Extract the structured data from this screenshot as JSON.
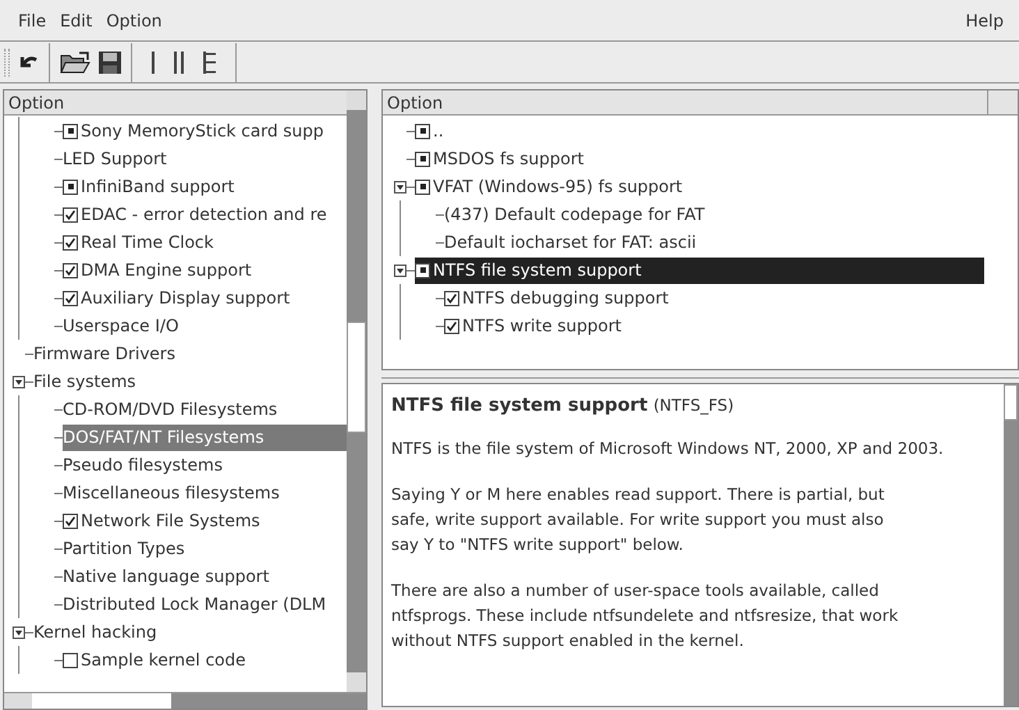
{
  "menu_bar": {
    "left": [
      "File",
      "Edit",
      "Option"
    ],
    "right": [
      "Help"
    ]
  },
  "left_tree": {
    "header": "Option",
    "items": [
      {
        "children": [
          {
            "label": "Sony MemoryStick card supp",
            "kind": "module",
            "selected": false
          },
          {
            "label": "LED Support",
            "kind": "none",
            "selected": false
          },
          {
            "label": "InfiniBand support",
            "kind": "module",
            "selected": false
          },
          {
            "label": "EDAC - error detection and re",
            "kind": "yes",
            "selected": false
          },
          {
            "label": "Real Time Clock",
            "kind": "yes",
            "selected": false
          },
          {
            "label": "DMA Engine support",
            "kind": "yes",
            "selected": false
          },
          {
            "label": "Auxiliary Display support",
            "kind": "yes",
            "selected": false
          },
          {
            "label": "Userspace I/O",
            "kind": "none",
            "selected": false
          }
        ]
      },
      {
        "label": "Firmware Drivers",
        "kind": "none",
        "selected": false
      },
      {
        "label": "File systems",
        "kind": "none",
        "selected": false,
        "expanded": true,
        "children": [
          {
            "label": "CD-ROM/DVD Filesystems",
            "kind": "none",
            "selected": false
          },
          {
            "label": "DOS/FAT/NT Filesystems",
            "kind": "none",
            "selected": true
          },
          {
            "label": "Pseudo filesystems",
            "kind": "none",
            "selected": false
          },
          {
            "label": "Miscellaneous filesystems",
            "kind": "none",
            "selected": false
          },
          {
            "label": "Network File Systems",
            "kind": "yes",
            "selected": false
          },
          {
            "label": "Partition Types",
            "kind": "none",
            "selected": false
          },
          {
            "label": "Native language support",
            "kind": "none",
            "selected": false
          },
          {
            "label": "Distributed Lock Manager (DLM",
            "kind": "none",
            "selected": false
          }
        ]
      },
      {
        "label": "Kernel hacking",
        "kind": "none",
        "selected": false,
        "expanded": true,
        "children": [
          {
            "label": "Sample kernel code",
            "kind": "no",
            "selected": false
          }
        ]
      }
    ]
  },
  "right_tree": {
    "header": "Option",
    "items": [
      {
        "label": "..",
        "kind": "module",
        "selected": false
      },
      {
        "label": "MSDOS fs support",
        "kind": "module",
        "selected": false
      },
      {
        "label": "VFAT (Windows-95) fs support",
        "kind": "module",
        "selected": false,
        "expanded": true,
        "children": [
          {
            "label": "(437) Default codepage for FAT",
            "kind": "none",
            "selected": false
          },
          {
            "label": "Default iocharset for FAT: ascii",
            "kind": "none",
            "selected": false
          }
        ]
      },
      {
        "label": "NTFS file system support",
        "kind": "module",
        "selected": true,
        "expanded": true,
        "children": [
          {
            "label": "NTFS debugging support",
            "kind": "yes",
            "selected": false
          },
          {
            "label": "NTFS write support",
            "kind": "yes",
            "selected": false
          }
        ]
      }
    ]
  },
  "help": {
    "title": "NTFS file system support",
    "symbol": "(NTFS_FS)",
    "paragraphs": [
      [
        "NTFS is the file system of Microsoft Windows NT, 2000, XP and 2003."
      ],
      [
        "Saying Y or M here enables read support. There is partial, but",
        "safe, write support available. For write support you must also",
        "say Y to \"NTFS write support\" below."
      ],
      [
        "There are also a number of user-space tools available, called",
        "ntfsprogs. These include ntfsundelete and ntfsresize, that work",
        "without NTFS support enabled in the kernel."
      ]
    ]
  }
}
